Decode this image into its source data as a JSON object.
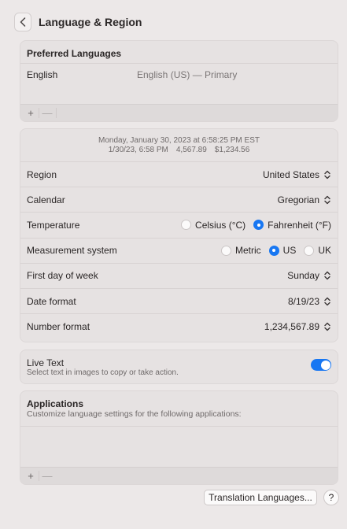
{
  "window": {
    "title": "Language & Region",
    "back_icon": "chevron-left-icon"
  },
  "preferred_languages": {
    "title": "Preferred Languages",
    "items": [
      {
        "name": "English",
        "detail": "English (US) — Primary"
      }
    ],
    "add_label": "+",
    "remove_label": "—"
  },
  "preview": {
    "line1": "Monday, January 30, 2023 at 6:58:25 PM EST",
    "date_short": "1/30/23, 6:58 PM",
    "number": "4,567.89",
    "currency": "$1,234.56"
  },
  "settings": {
    "region": {
      "label": "Region",
      "value": "United States"
    },
    "calendar": {
      "label": "Calendar",
      "value": "Gregorian"
    },
    "temperature": {
      "label": "Temperature",
      "options": [
        "Celsius (°C)",
        "Fahrenheit (°F)"
      ],
      "selected": "Fahrenheit (°F)"
    },
    "measurement": {
      "label": "Measurement system",
      "options": [
        "Metric",
        "US",
        "UK"
      ],
      "selected": "US"
    },
    "first_day": {
      "label": "First day of week",
      "value": "Sunday"
    },
    "date_format": {
      "label": "Date format",
      "value": "8/19/23"
    },
    "number_format": {
      "label": "Number format",
      "value": "1,234,567.89"
    }
  },
  "live_text": {
    "title": "Live Text",
    "subtitle": "Select text in images to copy or take action.",
    "enabled": true
  },
  "applications": {
    "title": "Applications",
    "subtitle": "Customize language settings for the following applications:",
    "add_label": "+",
    "remove_label": "—"
  },
  "buttons": {
    "translation": "Translation Languages...",
    "help": "?"
  },
  "colors": {
    "accent": "#1877f2",
    "background": "#ece8e8",
    "panel": "#e6e2e2"
  }
}
